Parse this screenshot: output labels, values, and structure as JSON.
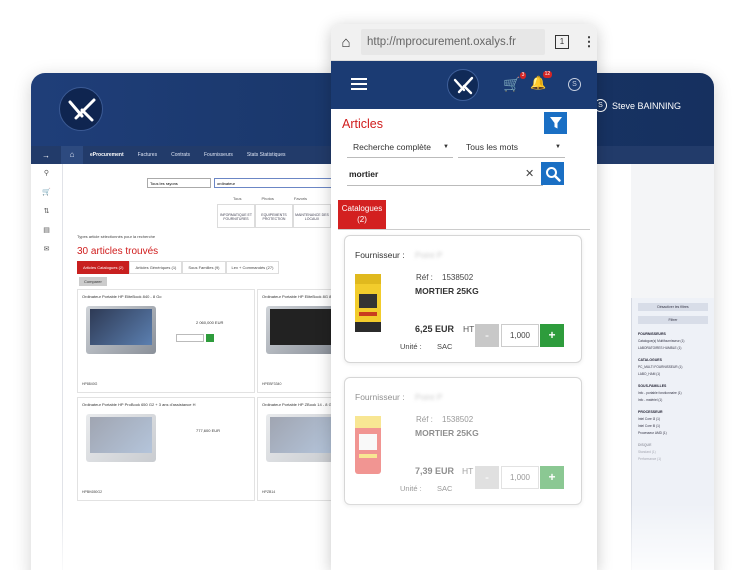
{
  "desktop": {
    "user_name": "Steve BAINNING",
    "nav": [
      "eProcurement",
      "Factures",
      "Contrats",
      "Fournisseurs",
      "Stats Statistiques"
    ],
    "search_scope": "Tous les rayons",
    "search_text": "ordinateur",
    "search_button": "Recherche avancée",
    "tabs": [
      "Tous",
      "Photos",
      "Favoris"
    ],
    "categories": [
      "INFORMATIQUE ET FOURNITURES",
      "EQUIPEMENTS PROTECTION",
      "MAINTENANCE DES LOCAUX",
      "FOURNITURES DE BUREAU"
    ],
    "check_text": "Types article sélectionnés pour la recherche",
    "result_count": "30 articles trouvés",
    "sub_tabs": [
      "Articles Catalogues (2)",
      "Articles Génériques (1)",
      "Sous Familles (9)",
      "Lex + Commandés (27)"
    ],
    "compare_label": "Comparer",
    "products": [
      {
        "title": "Ordinateur Portable HP EliteBook 840 - 8 Go",
        "price": "2 060,000 EUR",
        "supplier": "HEWLETT PACKARD",
        "ref": "HP8840G"
      },
      {
        "title": "Ordinateur Portable HP EliteBook 8G 8Go",
        "price": "",
        "supplier": "",
        "ref": "HPEBF3340"
      },
      {
        "title": "Ordinateur Portable HP ProBook 650 G2 + 3 ans d'assistance H",
        "price": "777,600 EUR",
        "supplier": "HEWLETT PACKARD",
        "ref": "HPBK650G2"
      },
      {
        "title": "Ordinateur Portable HP ZBook 14 - 8 Go",
        "price": "",
        "supplier": "",
        "ref": "HPZB14"
      }
    ],
    "filter": {
      "deactivate": "Désactiver les filtres",
      "apply": "Filtrer",
      "sections": [
        {
          "title": "FOURNISSEURS",
          "rows": [
            "Catalogue(s) Multifournisseur (1)",
            "LABORATOIRES HUMBLE (1)"
          ]
        },
        {
          "title": "CATALOGUES",
          "rows": [
            "PC_MULTI FOURNISSEUR (1)",
            "LABO_HAM (1)"
          ]
        },
        {
          "title": "SOUS-FAMILLES",
          "rows": [
            "Info - portable fonctionnaire (1)",
            "Info - matériel (1)"
          ]
        },
        {
          "title": "PROCESSEUR",
          "rows": [
            "Intel Core i3 (1)",
            "Intel Core i5 (1)",
            "Processeur AMD (1)"
          ]
        },
        {
          "title": "DISQUE",
          "rows": [
            "Standard (1)",
            "Performance (1)"
          ]
        }
      ]
    }
  },
  "browser": {
    "url": "http://mprocurement.oxalys.fr",
    "tab_count": "1"
  },
  "app": {
    "cart_badge": "3",
    "bell_badge": "12",
    "title": "Articles",
    "search_mode": "Recherche complète",
    "word_mode": "Tous les mots",
    "query": "mortier",
    "catalog_tab_line1": "Catalogues",
    "catalog_tab_line2": "(2)",
    "products": [
      {
        "supplier_label": "Fournisseur :",
        "supplier_name": "Point P",
        "ref_label": "Réf :",
        "ref": "1538502",
        "name": "MORTIER 25KG",
        "price": "6,25 EUR",
        "price_suffix": "HT",
        "unit_label": "Unité :",
        "unit": "SAC",
        "qty": "1,000",
        "minus": "-",
        "plus": "+"
      },
      {
        "supplier_label": "Fournisseur :",
        "supplier_name": "Point P",
        "ref_label": "Réf :",
        "ref": "1538502",
        "name": "MORTIER 25KG",
        "price": "7,39 EUR",
        "price_suffix": "HT",
        "unit_label": "Unité :",
        "unit": "SAC",
        "qty": "1,000",
        "minus": "-",
        "plus": "+"
      }
    ]
  },
  "colors": {
    "header_blue": "#1b3b73",
    "accent_red": "#d01c1c",
    "action_blue": "#1a6fc4",
    "add_green": "#2e9c3c"
  }
}
